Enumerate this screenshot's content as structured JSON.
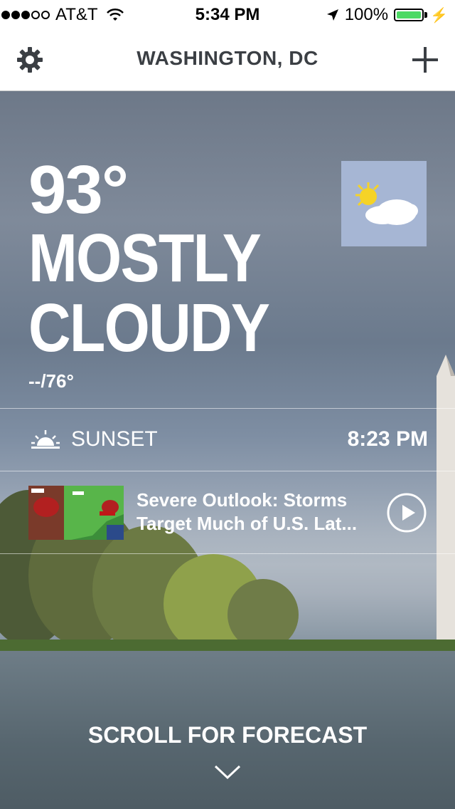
{
  "status_bar": {
    "carrier": "AT&T",
    "time": "5:34 PM",
    "battery": "100%",
    "signal_bars_filled": 3,
    "signal_bars_total": 5,
    "battery_level": 1.0
  },
  "nav": {
    "title": "WASHINGTON, DC",
    "settings_icon": "gear-icon",
    "add_icon": "plus-icon"
  },
  "current": {
    "temperature": "93°",
    "condition_line1": "MOSTLY",
    "condition_line2": "CLOUDY",
    "hi_lo": "--/76°",
    "condition_icon": "partly-cloudy-icon"
  },
  "sunset": {
    "label": "SUNSET",
    "time": "8:23 PM",
    "icon": "sunset-icon"
  },
  "video": {
    "title_line1": "Severe Outlook: Storms",
    "title_line2": "Target Much of U.S. Lat...",
    "icon": "play-icon"
  },
  "footer": {
    "scroll_label": "SCROLL FOR FORECAST",
    "icon": "chevron-down-icon"
  },
  "colors": {
    "battery_green": "#4cd964",
    "nav_title": "#3b3f44",
    "icon_tile": "#a6b6d4"
  }
}
